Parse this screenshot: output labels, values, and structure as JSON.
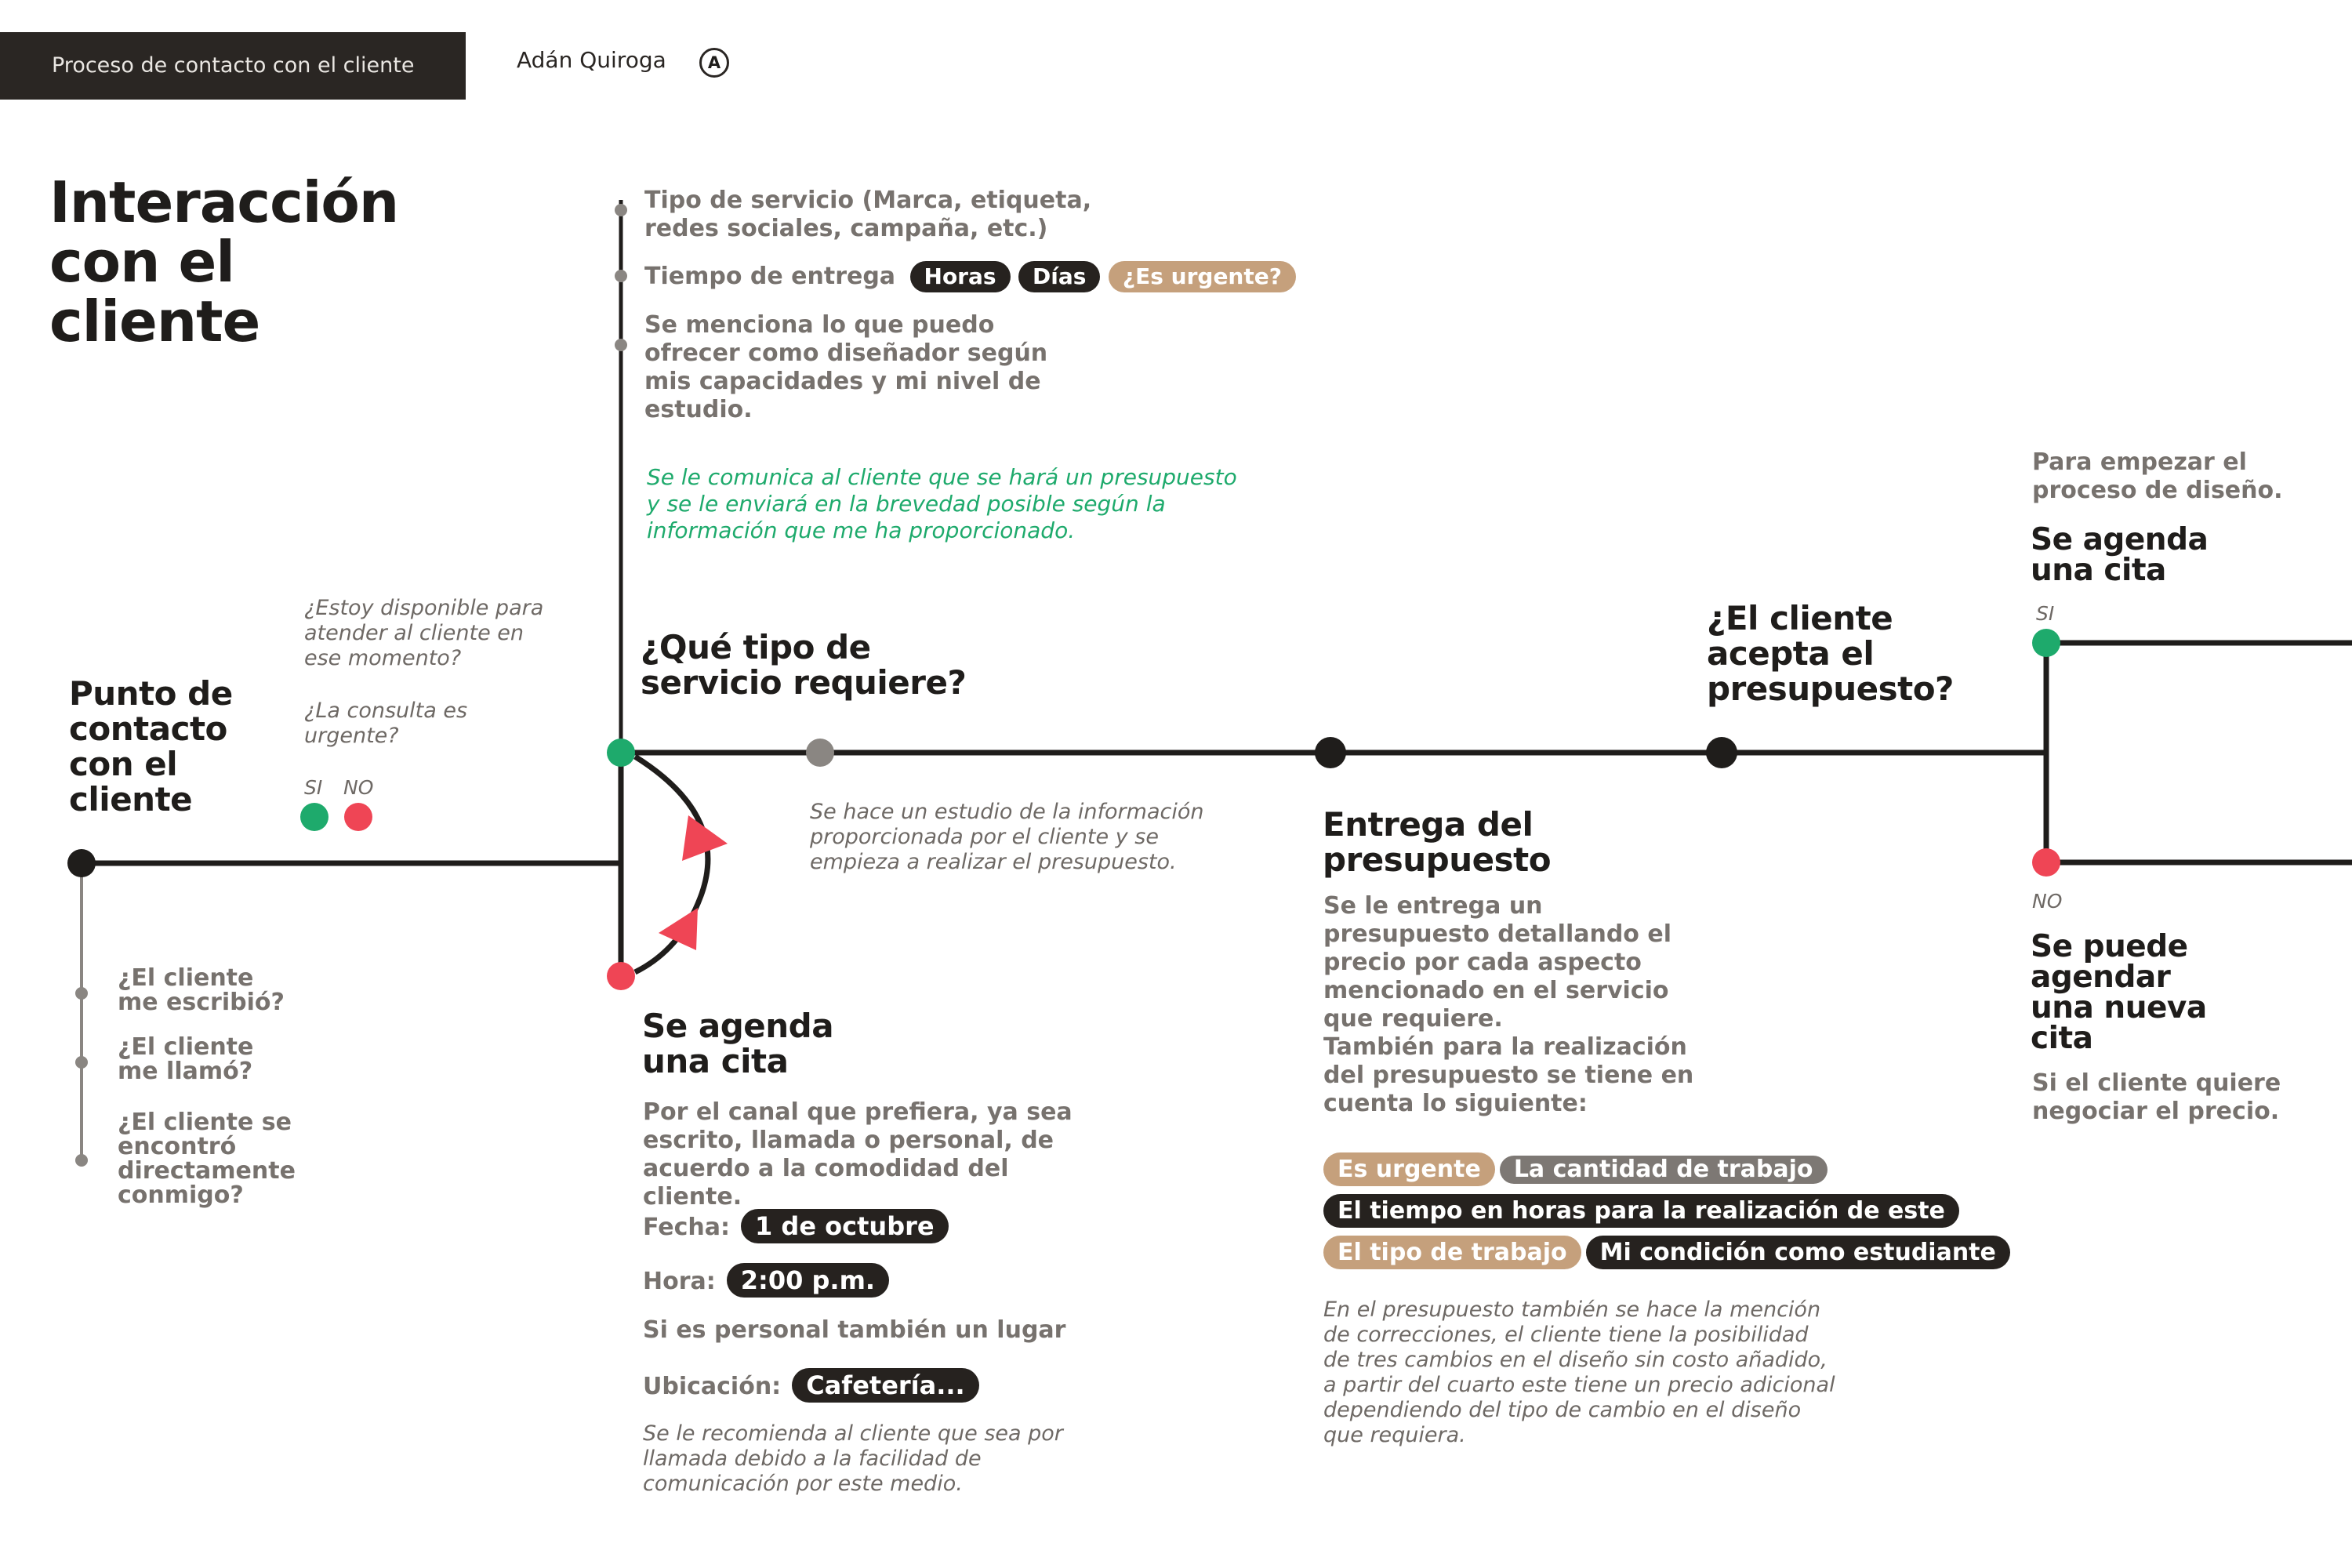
{
  "header": {
    "tab_label": "Proceso de contacto con el cliente",
    "author": "Adán Quiroga",
    "author_mark": "A"
  },
  "title": "Interacción con el cliente",
  "start": {
    "title": "Punto de contacto con el cliente",
    "questions": [
      "¿Estoy disponible para atender al cliente en ese momento?",
      "¿La consulta es urgente?"
    ],
    "si": "SI",
    "no": "NO",
    "channels": [
      "¿El cliente me escribió?",
      "¿El cliente me llamó?",
      "¿El cliente se encontró directamente conmigo?"
    ]
  },
  "service": {
    "title": "¿Qué tipo de servicio requiere?",
    "items": [
      "Tipo de servicio (Marca, etiqueta, redes sociales, campaña, etc.)",
      "Tiempo de entrega",
      "Se menciona lo que puedo ofrecer como diseñador según mis capacidades y mi nivel de estudio."
    ],
    "time_tags": [
      "Horas",
      "Días",
      "¿Es urgente?"
    ],
    "note_green": "Se le comunica al cliente que se hará un presupuesto y se le enviará en la brevedad posible según la información que me ha proporcionado.",
    "study_note": "Se hace un estudio de la información proporcionada por el cliente y se empieza a realizar el presupuesto."
  },
  "appointment": {
    "title": "Se agenda una cita",
    "desc": "Por el canal que prefiera, ya sea escrito, llamada o personal, de acuerdo a la comodidad del cliente.",
    "fecha_label": "Fecha:",
    "fecha_value": "1 de octubre",
    "hora_label": "Hora:",
    "hora_value": "2:00 p.m.",
    "personal_note": "Si es personal también un lugar",
    "ubicacion_label": "Ubicación:",
    "ubicacion_value": "Cafetería...",
    "recommend": "Se le recomienda al cliente que sea por llamada debido a la facilidad de comunicación por este medio."
  },
  "delivery": {
    "title": "Entrega del presupuesto",
    "desc": "Se le entrega un presupuesto detallando el precio por cada aspecto mencionado en el servicio que requiere.",
    "desc2": "También para la realización del presupuesto se tiene en cuenta lo siguiente:",
    "tags": [
      "Es urgente",
      "La cantidad de trabajo",
      "El tiempo en horas para la realización de este",
      "El tipo de trabajo",
      "Mi condición como estudiante"
    ],
    "note": "En el presupuesto también se hace la mención de correcciones, el cliente tiene la posibilidad de tres cambios en el diseño sin costo añadido, a partir del cuarto este tiene un precio adicional dependiendo del tipo de cambio en el diseño que requiera."
  },
  "accept": {
    "title": "¿El cliente acepta el presupuesto?",
    "si": "SI",
    "no": "NO",
    "yes_pre": "Para empezar el proceso de diseño.",
    "yes_title": "Se agenda una cita",
    "no_title": "Se puede agendar una nueva cita",
    "no_desc": "Si el cliente quiere negociar el precio."
  },
  "colors": {
    "line": "#1f1d1b",
    "yes": "#1eaa6c",
    "no": "#ef4555",
    "connector": "#8a8682",
    "tan": "#c5a07c",
    "dark_pill": "#26221f"
  }
}
